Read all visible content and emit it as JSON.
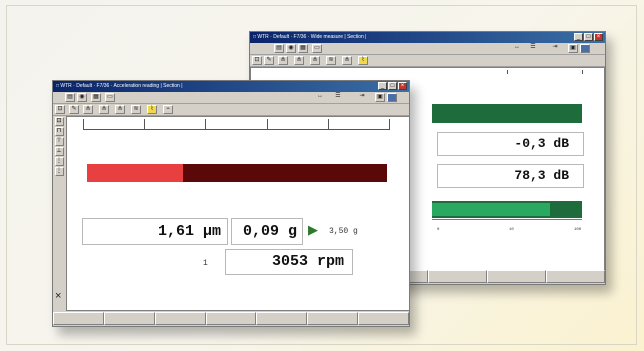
{
  "back_window": {
    "title": "□ WTR · Default · F7/36 · Wide measure | Section |",
    "level_db": "-0,3 dB",
    "peak_db": "78,3 dB",
    "scale_labels": [
      "0",
      "0",
      "10",
      "100"
    ]
  },
  "front_window": {
    "title": "□ WTR · Default · F7/36 · Acceleration reading | Section |",
    "displacement": "1,61 µm",
    "acceleration": "0,09 g",
    "play_symbol": "▶",
    "limit_value": "3,50 g",
    "channel_index": "1",
    "speed": "3053 rpm",
    "close_symbol": "×"
  },
  "colors": {
    "bar_bright_red": "#e84040",
    "bar_dark_red": "#5a0808",
    "bar_dark_green": "#1e6b3c",
    "bar_bright_green": "#28a860",
    "play_green": "#2d7a2d"
  },
  "icons": [
    "minimize-icon",
    "maximize-icon",
    "close-icon",
    "play-icon",
    "toolbar-icons"
  ]
}
